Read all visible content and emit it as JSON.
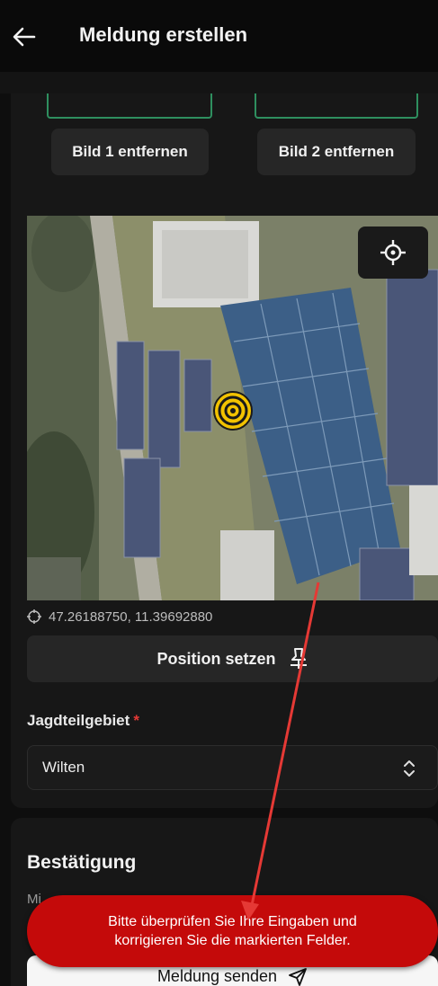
{
  "appbar": {
    "title": "Meldung erstellen",
    "back_icon": "arrow-left-icon"
  },
  "images": {
    "remove_buttons": [
      {
        "label": "Bild 1 entfernen"
      },
      {
        "label": "Bild 2 entfernen"
      }
    ]
  },
  "map": {
    "locate_icon": "crosshair-icon",
    "marker_icon": "target-marker-icon",
    "coordinates": "47.26188750, 11.39692880",
    "coordinates_icon": "crosshair-small-icon",
    "set_position_label": "Position setzen",
    "set_position_icon": "pin-icon"
  },
  "hunting_area": {
    "label": "Jagdteilgebiet",
    "required_marker": "*",
    "value": "Wilten",
    "chevron_icon": "chevron-up-down-icon"
  },
  "confirmation": {
    "title": "Bestätigung",
    "obscured_text": "Mi"
  },
  "submit": {
    "label": "Meldung senden",
    "icon": "send-icon"
  },
  "toast": {
    "line1": "Bitte überprüfen Sie Ihre Eingaben und",
    "line2": "korrigieren Sie die markierten Felder."
  },
  "colors": {
    "background": "#0e0e0e",
    "card": "#171717",
    "button": "#262626",
    "slot_border": "#2e8f5f",
    "toast": "#c40a0a",
    "annotation_arrow": "#e53935",
    "marker": "#f2c200"
  }
}
